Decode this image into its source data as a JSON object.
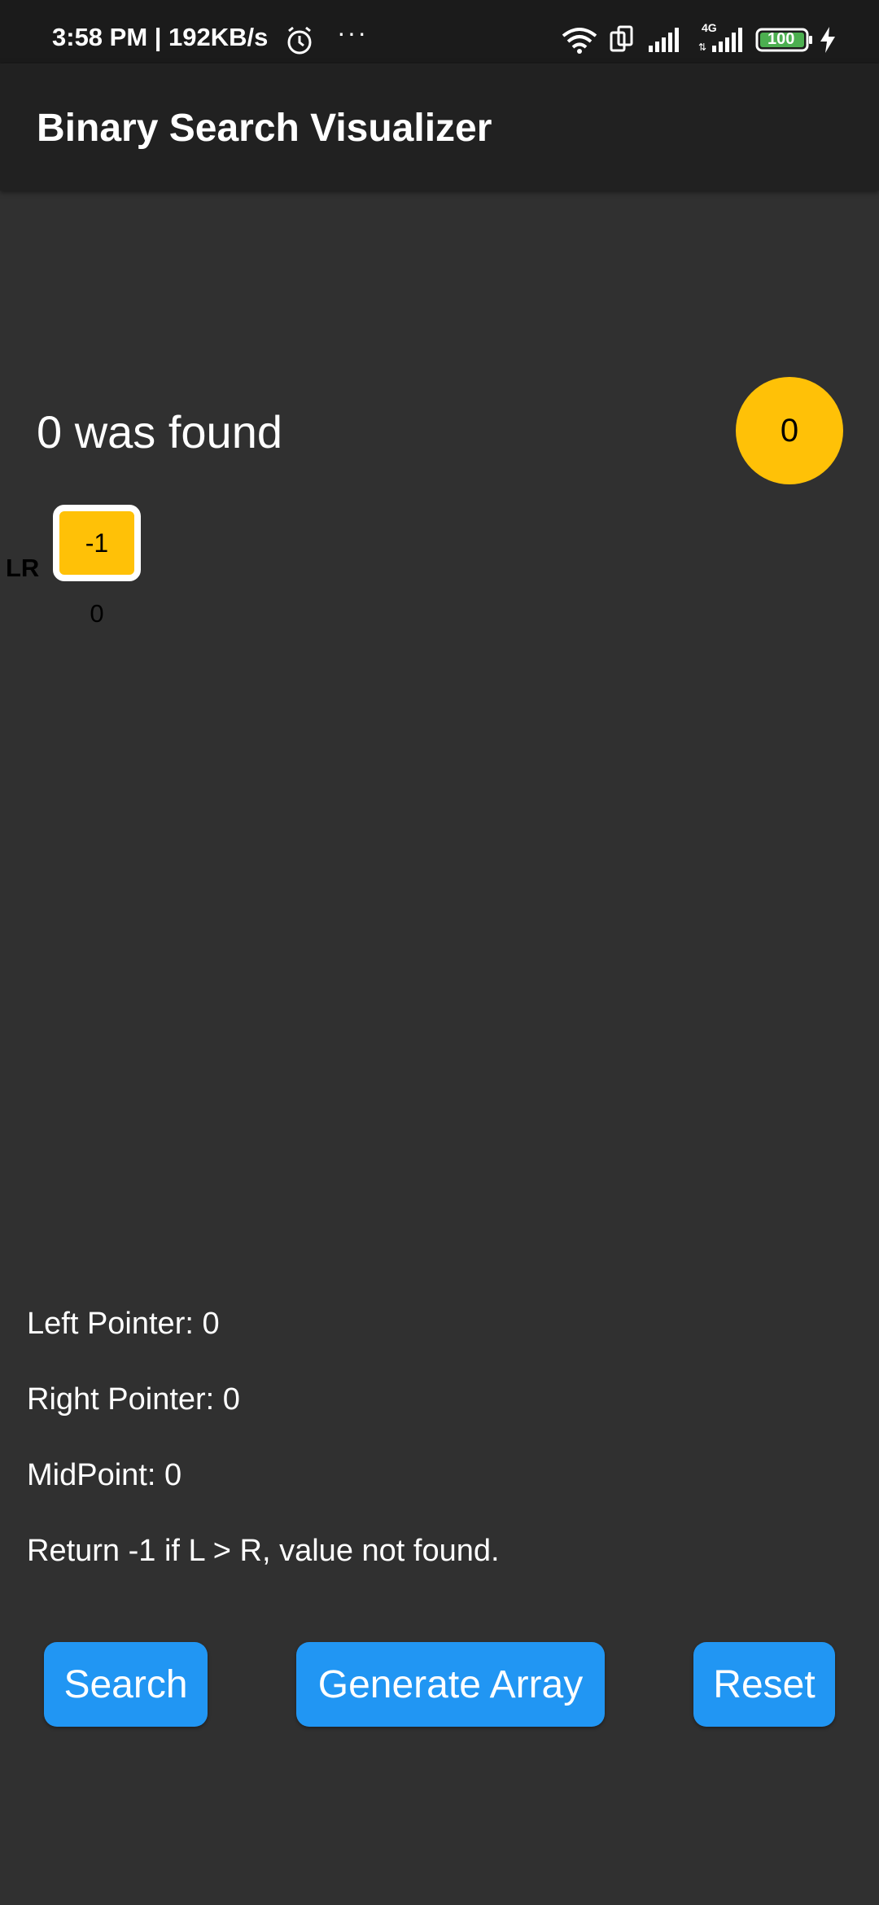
{
  "status_bar": {
    "time_speed": "3:58 PM | 192KB/s",
    "more_indicator": "···",
    "network_type": "4G",
    "battery_level": "100",
    "icons": [
      "alarm-icon",
      "wifi-icon",
      "screen-rotate-icon",
      "signal-icon",
      "signal-4g-icon",
      "battery-icon",
      "charging-icon"
    ]
  },
  "app_bar": {
    "title": "Binary Search Visualizer"
  },
  "result": {
    "message": "0 was found",
    "target_value": "0"
  },
  "array": {
    "pointer_label": "LR",
    "cells": [
      {
        "value": "-1",
        "index": "0"
      }
    ]
  },
  "info": {
    "left_pointer": "Left Pointer: 0",
    "right_pointer": "Right Pointer: 0",
    "midpoint": "MidPoint: 0",
    "note": "Return -1 if L > R, value not found."
  },
  "buttons": {
    "search": "Search",
    "generate": "Generate Array",
    "reset": "Reset"
  },
  "colors": {
    "background": "#303030",
    "app_bar": "#212121",
    "accent": "#ffc107",
    "button": "#2196f3"
  }
}
